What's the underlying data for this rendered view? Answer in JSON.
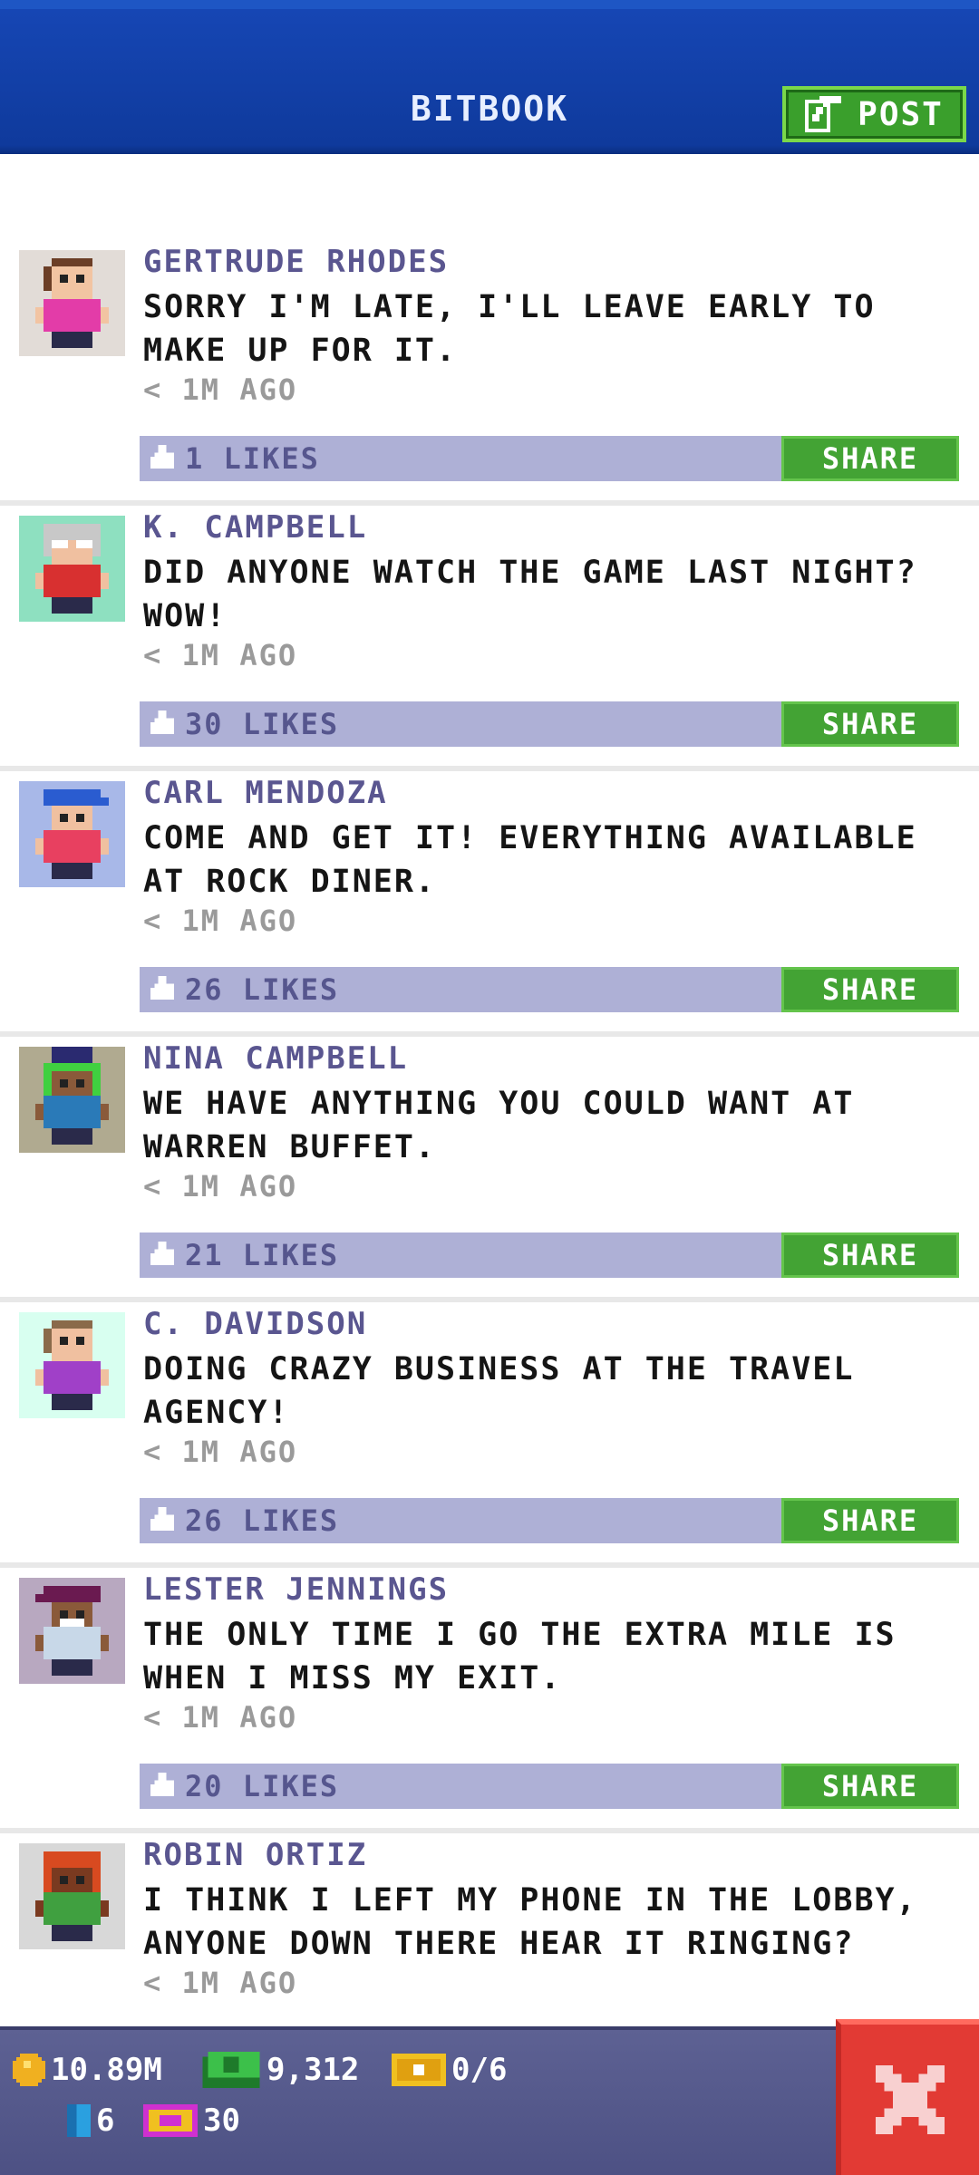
{
  "header": {
    "title": "BITBOOK",
    "post_label": "POST"
  },
  "share_label": "SHARE",
  "posts": [
    {
      "author": "GERTRUDE RHODES",
      "message": "SORRY I'M LATE, I'LL LEAVE EARLY TO MAKE UP FOR IT.",
      "time": "< 1M AGO",
      "likes": "1 LIKES"
    },
    {
      "author": "K. CAMPBELL",
      "message": "DID ANYONE WATCH THE GAME LAST NIGHT? WOW!",
      "time": "< 1M AGO",
      "likes": "30 LIKES"
    },
    {
      "author": "CARL MENDOZA",
      "message": "COME AND GET IT! EVERYTHING AVAILABLE AT ROCK DINER.",
      "time": "< 1M AGO",
      "likes": "26 LIKES"
    },
    {
      "author": "NINA CAMPBELL",
      "message": "WE HAVE ANYTHING YOU COULD WANT AT WARREN BUFFET.",
      "time": "< 1M AGO",
      "likes": "21 LIKES"
    },
    {
      "author": "C. DAVIDSON",
      "message": "DOING CRAZY BUSINESS AT THE TRAVEL AGENCY!",
      "time": "< 1M AGO",
      "likes": "26 LIKES"
    },
    {
      "author": "LESTER JENNINGS",
      "message": "THE ONLY TIME I GO THE EXTRA MILE IS WHEN I MISS MY EXIT.",
      "time": "< 1M AGO",
      "likes": "20 LIKES"
    },
    {
      "author": "ROBIN ORTIZ",
      "message": "I THINK I LEFT MY PHONE IN THE LOBBY, ANYONE DOWN THERE HEAR IT RINGING?",
      "time": "< 1M AGO",
      "likes": ""
    }
  ],
  "status": {
    "coins": "10.89M",
    "bux": "9,312",
    "tickets": "0/6",
    "keys": "6",
    "vip": "30"
  },
  "colors": {
    "header_blue": "#1646b4",
    "accent_green": "#43a334",
    "like_bar": "#aeb0d6",
    "close_red": "#e23a34"
  },
  "icons": [
    "edit-icon",
    "like-icon",
    "coin-icon",
    "bux-icon",
    "ticket-icon",
    "key-icon",
    "vip-icon",
    "close-icon"
  ]
}
